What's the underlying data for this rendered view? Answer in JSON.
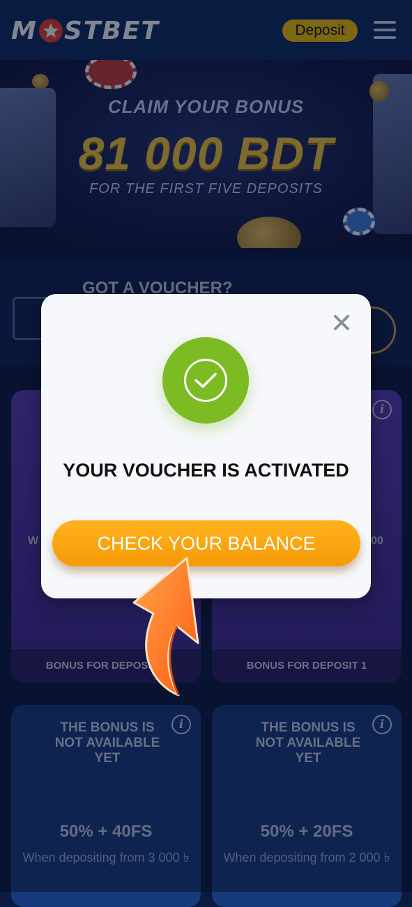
{
  "header": {
    "logo_text": "MOSTBET",
    "deposit_label": "Deposit",
    "menu_icon": "hamburger-menu-icon"
  },
  "banner": {
    "line1": "CLAIM YOUR BONUS",
    "line2": "81 000 BDT",
    "line3": "FOR THE FIRST FIVE DEPOSITS"
  },
  "voucher": {
    "label": "GOT A VOUCHER?"
  },
  "cards": [
    {
      "peek_text": "W",
      "footer": "BONUS FOR DEPOSIT 1"
    },
    {
      "peek_text": "00",
      "footer": "BONUS FOR DEPOSIT 1"
    },
    {
      "badge": "THE BONUS IS NOT AVAILABLE YET",
      "offer": "50% + 40FS",
      "note": "When depositing from 3 000 ৳"
    },
    {
      "badge": "THE BONUS IS NOT AVAILABLE YET",
      "offer": "50% + 20FS",
      "note": "When depositing from 2 000 ৳"
    }
  ],
  "modal": {
    "title": "YOUR VOUCHER IS ACTIVATED",
    "button_label": "CHECK YOUR BALANCE",
    "close_icon": "close-icon",
    "success_icon": "check-circle-icon"
  },
  "colors": {
    "header_bg": "#0f2a5f",
    "brand_yellow": "#f5c400",
    "success_green": "#7dbb25",
    "button_orange": "#f7a30e",
    "arrow_orange": "#ff6a1a"
  }
}
